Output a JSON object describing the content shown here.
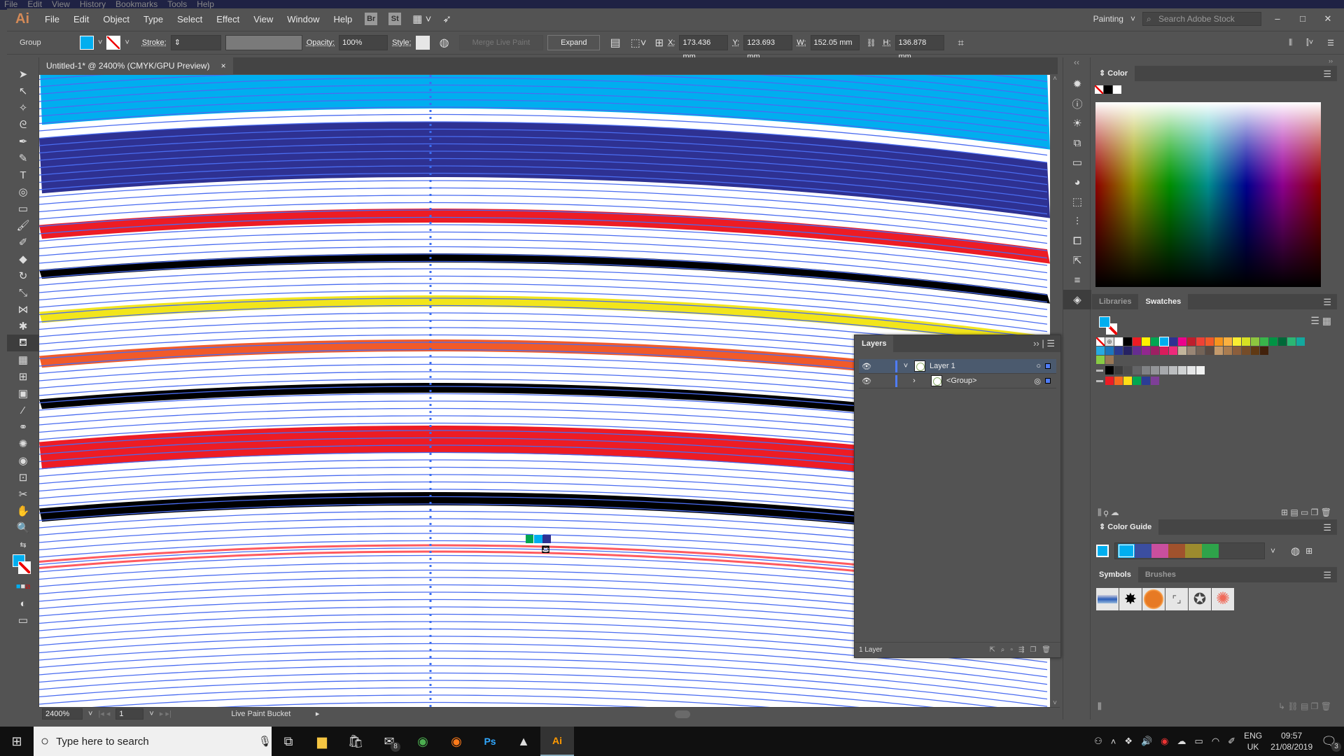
{
  "browser_menu": [
    "File",
    "Edit",
    "View",
    "History",
    "Bookmarks",
    "Tools",
    "Help"
  ],
  "app": {
    "logo": "Ai",
    "menu": [
      "File",
      "Edit",
      "Object",
      "Type",
      "Select",
      "Effect",
      "View",
      "Window",
      "Help"
    ],
    "bridge": "Br",
    "stock": "St",
    "workspace": "Painting",
    "search_placeholder": "Search Adobe Stock"
  },
  "control": {
    "selection": "Group",
    "fill_color": "#00aeef",
    "stroke_label": "Stroke:",
    "opacity_label": "Opacity:",
    "opacity": "100%",
    "style_label": "Style:",
    "merge_label": "Merge Live Paint",
    "expand_label": "Expand",
    "x_label": "X:",
    "x": "173.436 mm",
    "y_label": "Y:",
    "y": "123.693 mm",
    "w_label": "W:",
    "w": "152.05 mm",
    "h_label": "H:",
    "h": "136.878 mm"
  },
  "document": {
    "tab": "Untitled-1* @ 2400% (CMYK/GPU Preview)",
    "close": "×"
  },
  "status": {
    "zoom": "2400%",
    "artboard": "1",
    "tool": "Live Paint Bucket"
  },
  "artwork": {
    "line_color": "#4a6cf0",
    "bands": [
      {
        "color": "#00aeef"
      },
      {
        "color": "#2e3192"
      },
      {
        "color": "#ed1c24"
      },
      {
        "color": "#000000"
      },
      {
        "color": "#f2e51b"
      },
      {
        "color": "#f15a29"
      },
      {
        "color": "#000000"
      },
      {
        "color": "#ed1c24"
      },
      {
        "color": "#000000"
      },
      {
        "color": "#ff5a5f"
      }
    ],
    "cursor_swatches": [
      "#00a651",
      "#00aeef",
      "#2e3192"
    ]
  },
  "layers": {
    "title": "Layers",
    "rows": [
      {
        "name": "Layer 1"
      },
      {
        "name": "<Group>"
      }
    ],
    "footer": "1 Layer"
  },
  "color_panel": {
    "title": "Color"
  },
  "swatches": {
    "tab_libraries": "Libraries",
    "tab_swatches": "Swatches",
    "row1": [
      "#ffffff",
      "#000000",
      "#ed1c24",
      "#fff200",
      "#00a651",
      "#00aeef",
      "#2e3192",
      "#ec008c",
      "#be1e2d",
      "#ef4136",
      "#f15a29",
      "#f7941d",
      "#fbb040",
      "#f9ed32",
      "#d7df23",
      "#8dc63f",
      "#39b54a",
      "#009444",
      "#006838",
      "#2bb673",
      "#13a89e"
    ],
    "row2": [
      "#27aae1",
      "#1c75bc",
      "#2b3990",
      "#262262",
      "#662d91",
      "#92278f",
      "#9e1f63",
      "#da1c5c",
      "#ee2a7b",
      "#c2b59b",
      "#998675",
      "#736357",
      "#594a42",
      "#c49a6c",
      "#a97c50",
      "#8b5e3c",
      "#754c29",
      "#603913",
      "#42210b"
    ],
    "grays": [
      "#000000",
      "#3c3c3c",
      "#4d4d4d",
      "#636466",
      "#808285",
      "#939598",
      "#a7a9ac",
      "#bcbec0",
      "#d1d3d4",
      "#e6e7e8",
      "#f1f2f2"
    ],
    "brights": [
      "#ed1c24",
      "#f7691f",
      "#ffde17",
      "#00a651",
      "#2b3d96",
      "#7e3f98"
    ]
  },
  "color_guide": {
    "title": "Color Guide",
    "colors": [
      "#00aeef",
      "#3b4ea0",
      "#c94f9e",
      "#a0522d",
      "#9c8b2e",
      "#2ea34a"
    ]
  },
  "symbols": {
    "tab_symbols": "Symbols",
    "tab_brushes": "Brushes"
  },
  "taskbar": {
    "search_placeholder": "Type here to search",
    "mail_badge": "8",
    "lang1": "ENG",
    "lang2": "UK",
    "time": "09:57",
    "date": "21/08/2019",
    "notif_badge": "3"
  }
}
